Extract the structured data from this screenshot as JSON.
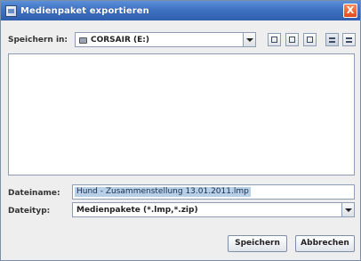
{
  "window": {
    "title": "Medienpaket exportieren",
    "close_label": "X"
  },
  "look_in": {
    "label": "Speichern in:",
    "value": "CORSAIR (E:)"
  },
  "toolbar": {
    "icons": [
      "up-folder-icon",
      "home-icon",
      "new-folder-icon",
      "list-view-icon",
      "details-view-icon"
    ]
  },
  "file_name": {
    "label": "Dateiname:",
    "value": "Hund - Zusammenstellung 13.01.2011.lmp"
  },
  "file_type": {
    "label": "Dateityp:",
    "value": "Medienpakete (*.lmp,*.zip)"
  },
  "buttons": {
    "save": "Speichern",
    "cancel": "Abbrechen"
  },
  "colors": {
    "titlebar": "#3f72c2",
    "selection": "#b8cfe8"
  }
}
